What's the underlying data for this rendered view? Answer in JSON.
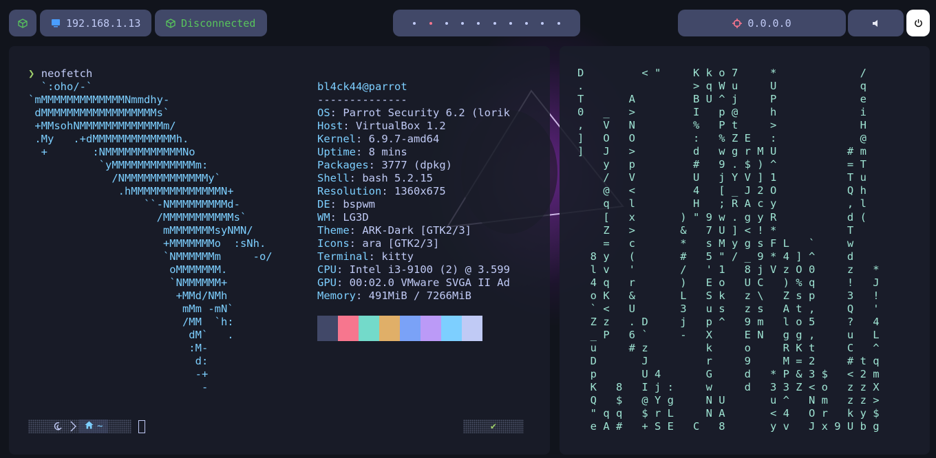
{
  "topbar": {
    "ip": "192.168.1.13",
    "vpn_status": "Disconnected",
    "target": "0.0.0.0",
    "workspaces": [
      false,
      true,
      false,
      false,
      false,
      false,
      false,
      false,
      false,
      false
    ],
    "colors": {
      "pill": "#414868",
      "vpn": "#58c45c",
      "ip_icon": "#4a9eff",
      "target_icon": "#f7768e",
      "active_ws": "#f7768e"
    },
    "icons": {
      "cube": "cube-icon",
      "ip": "monitor-icon",
      "vpn": "cube-icon",
      "target": "crosshair-icon",
      "volume": "speaker-icon",
      "power": "power-icon"
    }
  },
  "terminal_left": {
    "prompt_symbol": "❯",
    "command": "neofetch",
    "ascii_art": [
      "  `:oho/-`",
      "`mMMMMMMMMMMMMMNmmdhy-",
      " dMMMMMMMMMMMMMMMMMMs`",
      " +MMsohNMMMMMMMMMMMMMm/",
      " .My   .+dMMMMMMMMMMMMMh.",
      "  +       :NMMMMMMMMMMMMNo",
      "           `yMMMMMMMMMMMMMm:",
      "             /NMMMMMMMMMMMMMy`",
      "              .hMMMMMMMMMMMMMMN+",
      "                  ``-NMMMMMMMMMd-",
      "                    /MMMMMMMMMMMs`",
      "                     mMMMMMMMsyNMN/",
      "                     +MMMMMMMo  :sNh.",
      "                     `NMMMMMMm     -o/",
      "                      oMMMMMMM.",
      "                      `NMMMMMM+",
      "                       +MMd/NMh",
      "                        mMm -mN`",
      "                        /MM  `h:",
      "                         dM`   .",
      "                         :M-",
      "                          d:",
      "                          -+",
      "                           -"
    ],
    "user_host": "bl4ck44@parrot",
    "separator": "--------------",
    "info": [
      {
        "key": "OS",
        "value": "Parrot Security 6.2 (lorik"
      },
      {
        "key": "Host",
        "value": "VirtualBox 1.2"
      },
      {
        "key": "Kernel",
        "value": "6.9.7-amd64"
      },
      {
        "key": "Uptime",
        "value": "8 mins"
      },
      {
        "key": "Packages",
        "value": "3777 (dpkg)"
      },
      {
        "key": "Shell",
        "value": "bash 5.2.15"
      },
      {
        "key": "Resolution",
        "value": "1360x675"
      },
      {
        "key": "DE",
        "value": "bspwm"
      },
      {
        "key": "WM",
        "value": "LG3D"
      },
      {
        "key": "Theme",
        "value": "ARK-Dark [GTK2/3]"
      },
      {
        "key": "Icons",
        "value": "ara [GTK2/3]"
      },
      {
        "key": "Terminal",
        "value": "kitty"
      },
      {
        "key": "CPU",
        "value": "Intel i3-9100 (2) @ 3.599"
      },
      {
        "key": "GPU",
        "value": "00:02.0 VMware SVGA II Ad"
      },
      {
        "key": "Memory",
        "value": "491MiB / 7266MiB"
      }
    ],
    "palette": [
      "#414868",
      "#f7768e",
      "#73daca",
      "#e0af68",
      "#7aa2f7",
      "#bb9af7",
      "#7dcfff",
      "#c0caf5"
    ],
    "statusbar": {
      "dir": "~",
      "check": "✔"
    }
  },
  "terminal_right": {
    "matrix_rows": [
      "D         < \"     K k o 7     *             /",
      ".                 > q W u     U             q",
      "T       A         B U ^ j     P             e",
      "0   _   >         I   p @     h             i",
      ",   V   N         %   P t     >             H",
      "]   O   O         :   % Z E   :             @",
      "]   J   >         d   w g r M U           # m",
      "    y   p         #   9 . $ ) ^           = T",
      "    /   V         U   j Y V ] 1           T u",
      "    @   <         4   [ _ J 2 O           Q h",
      "    q   l         H   ; R A c y           , l",
      "    [   x       ) \" 9 w . g y R           d (",
      "    Z   >       &   7 U ] < ! *           T",
      "    =   c       *   s M y g s F L   `     w",
      "  8 y   (       #   5 \" / _ 9 * 4 ] ^     d",
      "  l v   '       /   ' 1   8 j V z O 0     z   *",
      "  4 q   r       )   E o   U C   ) % q     !   J",
      "  o K   &       L   S k   z \\   Z s p     3   !",
      "  ` <   U       3   u s   z s   A t ,     Q   '",
      "  Z z   . D     j   p ^   9 m   l o 5     ?   4",
      "  _ P   6 `     -   X     E N   g g ,     u   L",
      "  u     # z         k     o     R K t     C   ^",
      "  D       J         r     9     M = 2     # t q",
      "  p       U 4       G     d   * P & 3 $   < 2 m",
      "  K   8   I j :     w     d   3 3 Z < o   z z X",
      "  Q   $   @ Y g     N U       u ^   N m   z z >",
      "  \" q q   $ r L     N A       < 4   O r   k y $",
      "  e A #   + S E   C   8       y v   J x 9 U b g"
    ]
  }
}
